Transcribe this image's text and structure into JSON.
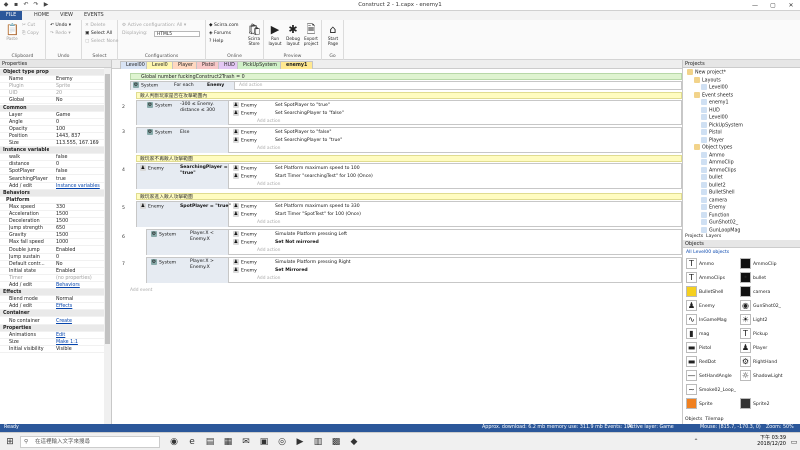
{
  "window": {
    "title": "Construct 2 - 1.capx - enemy1"
  },
  "ribbon_tabs": [
    "FILE",
    "HOME",
    "VIEW",
    "EVENTS"
  ],
  "ribbon": {
    "clipboard": {
      "paste": "Paste",
      "cut": "Cut",
      "copy": "Copy",
      "label": "Clipboard"
    },
    "undo": {
      "undo": "Undo",
      "redo": "Redo",
      "label": "Undo"
    },
    "select": {
      "delete": "Delete",
      "select_all": "Select All",
      "select_none": "Select None",
      "label": "Select"
    },
    "configurations": {
      "active": "Active configuration: All",
      "displaying": "Displaying:",
      "value": "HTML5",
      "label": "Configurations"
    },
    "online": {
      "scirra": "Scirra.com",
      "forums": "Forums",
      "help": "Help",
      "store": "Scirra Store",
      "label": "Online"
    },
    "preview": {
      "run": "Run layout",
      "debug": "Debug layout",
      "export": "Export project",
      "label": "Preview"
    },
    "go": {
      "start": "Start Page",
      "label": "Go"
    }
  },
  "doc_tabs": [
    "Level00",
    "Level0",
    "Player",
    "Pistol",
    "HUD",
    "PickUpSystem",
    "enemy1"
  ],
  "properties": {
    "title": "Properties",
    "rows": [
      {
        "k": "Object type properties",
        "v": "",
        "t": "sec"
      },
      {
        "k": "Name",
        "v": "Enemy"
      },
      {
        "k": "Plugin",
        "v": "Sprite",
        "t": "dim"
      },
      {
        "k": "UID",
        "v": "20",
        "t": "dim"
      },
      {
        "k": "Global",
        "v": "No"
      },
      {
        "k": "Common",
        "v": "",
        "t": "sec"
      },
      {
        "k": "Layer",
        "v": "Game"
      },
      {
        "k": "Angle",
        "v": "0"
      },
      {
        "k": "Opacity",
        "v": "100"
      },
      {
        "k": "Position",
        "v": "1443, 837"
      },
      {
        "k": "Size",
        "v": "113.555, 167.169"
      },
      {
        "k": "Instance variables",
        "v": "",
        "t": "sec"
      },
      {
        "k": "walk",
        "v": "false"
      },
      {
        "k": "distance",
        "v": "0"
      },
      {
        "k": "SpotPlayer",
        "v": "false"
      },
      {
        "k": "SearchingPlayer",
        "v": "true"
      },
      {
        "k": "Add / edit",
        "v": "Instance variables",
        "t": "link"
      },
      {
        "k": "Behaviors",
        "v": "",
        "t": "sec"
      },
      {
        "k": "Platform",
        "v": "",
        "t": "sub"
      },
      {
        "k": "Max speed",
        "v": "330"
      },
      {
        "k": "Acceleration",
        "v": "1500"
      },
      {
        "k": "Deceleration",
        "v": "1500"
      },
      {
        "k": "Jump strength",
        "v": "650"
      },
      {
        "k": "Gravity",
        "v": "1500"
      },
      {
        "k": "Max fall speed",
        "v": "1000"
      },
      {
        "k": "Double jump",
        "v": "Enabled"
      },
      {
        "k": "Jump sustain",
        "v": "0"
      },
      {
        "k": "Default contr...",
        "v": "No"
      },
      {
        "k": "Initial state",
        "v": "Enabled"
      },
      {
        "k": "Timer",
        "v": "(no properties)",
        "t": "dim"
      },
      {
        "k": "Add / edit",
        "v": "Behaviors",
        "t": "link"
      },
      {
        "k": "Effects",
        "v": "",
        "t": "sec"
      },
      {
        "k": "Blend mode",
        "v": "Normal"
      },
      {
        "k": "Add / edit",
        "v": "Effects",
        "t": "link"
      },
      {
        "k": "Container",
        "v": "",
        "t": "sec"
      },
      {
        "k": "No container",
        "v": "Create",
        "t": "link"
      },
      {
        "k": "Properties",
        "v": "",
        "t": "sec"
      },
      {
        "k": "Animations",
        "v": "Edit",
        "t": "link"
      },
      {
        "k": "Size",
        "v": "Make 1:1",
        "t": "link"
      },
      {
        "k": "Initial visibility",
        "v": "Visible"
      }
    ]
  },
  "sheet": {
    "global_var": "Global number fuckingConstruct2Trash = 0",
    "e1": {
      "num": "1",
      "obj": "System",
      "cond": "For each",
      "target": "Enemy",
      "add": "Add action"
    },
    "comment1": "敵人判斷玩家是否在攻擊範圍內",
    "e2": {
      "num": "2",
      "obj": "System",
      "cond": "-300 ≤ Enemy. distance ≤ 300",
      "a1_obj": "Enemy",
      "a1": "Set SpotPlayer to \"true\"",
      "a2_obj": "Enemy",
      "a2": "Set SearchingPlayer to \"false\"",
      "add": "Add action"
    },
    "e3": {
      "num": "3",
      "obj": "System",
      "cond": "Else",
      "a1_obj": "Enemy",
      "a1": "Set SpotPlayer to \"false\"",
      "a2_obj": "Enemy",
      "a2": "Set SearchingPlayer to \"true\"",
      "add": "Add action"
    },
    "comment2": "敵玩家不再敵人攻擊範圍",
    "e4": {
      "num": "4",
      "obj": "Enemy",
      "cond": "SearchingPlayer = \"true\"",
      "a1_obj": "Enemy",
      "a1": "Set Platform maximum speed to 100",
      "a2_obj": "Enemy",
      "a2": "Start Timer \"searchingTest\" for 100 (Once)",
      "add": "Add action"
    },
    "comment3": "敵玩家進入敵人攻擊範圍",
    "e5": {
      "num": "5",
      "obj": "Enemy",
      "cond": "SpotPlayer = \"true\"",
      "a1_obj": "Enemy",
      "a1": "Set Platform maximum speed to 330",
      "a2_obj": "Enemy",
      "a2": "Start Timer \"SpotTest\" for 100 (Once)",
      "add": "Add action"
    },
    "e6": {
      "num": "6",
      "obj": "System",
      "cond": "Player.X < Enemy.X",
      "a1_obj": "Enemy",
      "a1": "Simulate Platform pressing Left",
      "a2_obj": "Enemy",
      "a2": "Set Not mirrored",
      "add": "Add action"
    },
    "e7": {
      "num": "7",
      "obj": "System",
      "cond": "Player.X > Enemy.X",
      "a1_obj": "Enemy",
      "a1": "Simulate Platform pressing Right",
      "a2_obj": "Enemy",
      "a2": "Set Mirrored",
      "add": "Add action"
    },
    "add_event": "Add event"
  },
  "projects": {
    "title": "Projects",
    "items": [
      {
        "t": "New project*",
        "lvl": 0
      },
      {
        "t": "Layouts",
        "lvl": 1
      },
      {
        "t": "Level00",
        "lvl": 2
      },
      {
        "t": "Event sheets",
        "lvl": 1
      },
      {
        "t": "enemy1",
        "lvl": 2
      },
      {
        "t": "HUD",
        "lvl": 2
      },
      {
        "t": "Level00",
        "lvl": 2
      },
      {
        "t": "PickUpSystem",
        "lvl": 2
      },
      {
        "t": "Pistol",
        "lvl": 2
      },
      {
        "t": "Player",
        "lvl": 2
      },
      {
        "t": "Object types",
        "lvl": 1
      },
      {
        "t": "Ammo",
        "lvl": 2
      },
      {
        "t": "AmmoClip",
        "lvl": 2
      },
      {
        "t": "AmmoClips",
        "lvl": 2
      },
      {
        "t": "bullet",
        "lvl": 2
      },
      {
        "t": "bullet2",
        "lvl": 2
      },
      {
        "t": "BulletShell",
        "lvl": 2
      },
      {
        "t": "camera",
        "lvl": 2
      },
      {
        "t": "Enemy",
        "lvl": 2
      },
      {
        "t": "Function",
        "lvl": 2
      },
      {
        "t": "GunShot02_",
        "lvl": 2
      },
      {
        "t": "GunLoopMag",
        "lvl": 2
      }
    ],
    "tabs": [
      "Projects",
      "Layers"
    ]
  },
  "objects": {
    "title": "Objects",
    "filter": "All Level00 objects",
    "items": [
      {
        "n": "Ammo",
        "c": "#ffffff",
        "g": "T"
      },
      {
        "n": "AmmoClip",
        "c": "#111111",
        "g": ""
      },
      {
        "n": "AmmoClips",
        "c": "#ffffff",
        "g": "T"
      },
      {
        "n": "bullet",
        "c": "#111111",
        "g": "•"
      },
      {
        "n": "BulletShell",
        "c": "#f5d020",
        "g": ""
      },
      {
        "n": "camera",
        "c": "#111111",
        "g": ""
      },
      {
        "n": "Enemy",
        "c": "#ffffff",
        "g": "♟"
      },
      {
        "n": "GunShot02_",
        "c": "#ffffff",
        "g": "◉"
      },
      {
        "n": "InGameMag",
        "c": "#ffffff",
        "g": "∿"
      },
      {
        "n": "Light2",
        "c": "#ffffff",
        "g": "☀"
      },
      {
        "n": "mag",
        "c": "#ffffff",
        "g": "▮"
      },
      {
        "n": "Pickup",
        "c": "#ffffff",
        "g": "T"
      },
      {
        "n": "Pistol",
        "c": "#ffffff",
        "g": "▬"
      },
      {
        "n": "Player",
        "c": "#ffffff",
        "g": "♟"
      },
      {
        "n": "RedDot",
        "c": "#ffffff",
        "g": "▬"
      },
      {
        "n": "RightHand",
        "c": "#ffffff",
        "g": "⚙"
      },
      {
        "n": "SetHandAngle",
        "c": "#ffffff",
        "g": "—"
      },
      {
        "n": "ShadowLight",
        "c": "#ffffff",
        "g": "☼"
      },
      {
        "n": "Smoke02_Loop_",
        "c": "#ffffff",
        "g": "~"
      },
      {
        "n": "",
        "c": "#ffffff",
        "g": ""
      },
      {
        "n": "Sprite",
        "c": "#f08020",
        "g": ""
      },
      {
        "n": "Sprite2",
        "c": "#333333",
        "g": ""
      }
    ],
    "tabs": [
      "Objects",
      "Tilemap"
    ]
  },
  "status": {
    "left": "Ready",
    "mid": "Approx. download: 6.2 mb  memory use: 311.9 mb  Events: 106",
    "layer": "Active layer: Game",
    "mouse": "Mouse: (815.7, -170.3, 0)",
    "zoom": "Zoom: 50%"
  },
  "taskbar": {
    "search": "在這裡輸入文字來搜尋",
    "time": "下午 03:39",
    "date": "2018/12/20"
  }
}
